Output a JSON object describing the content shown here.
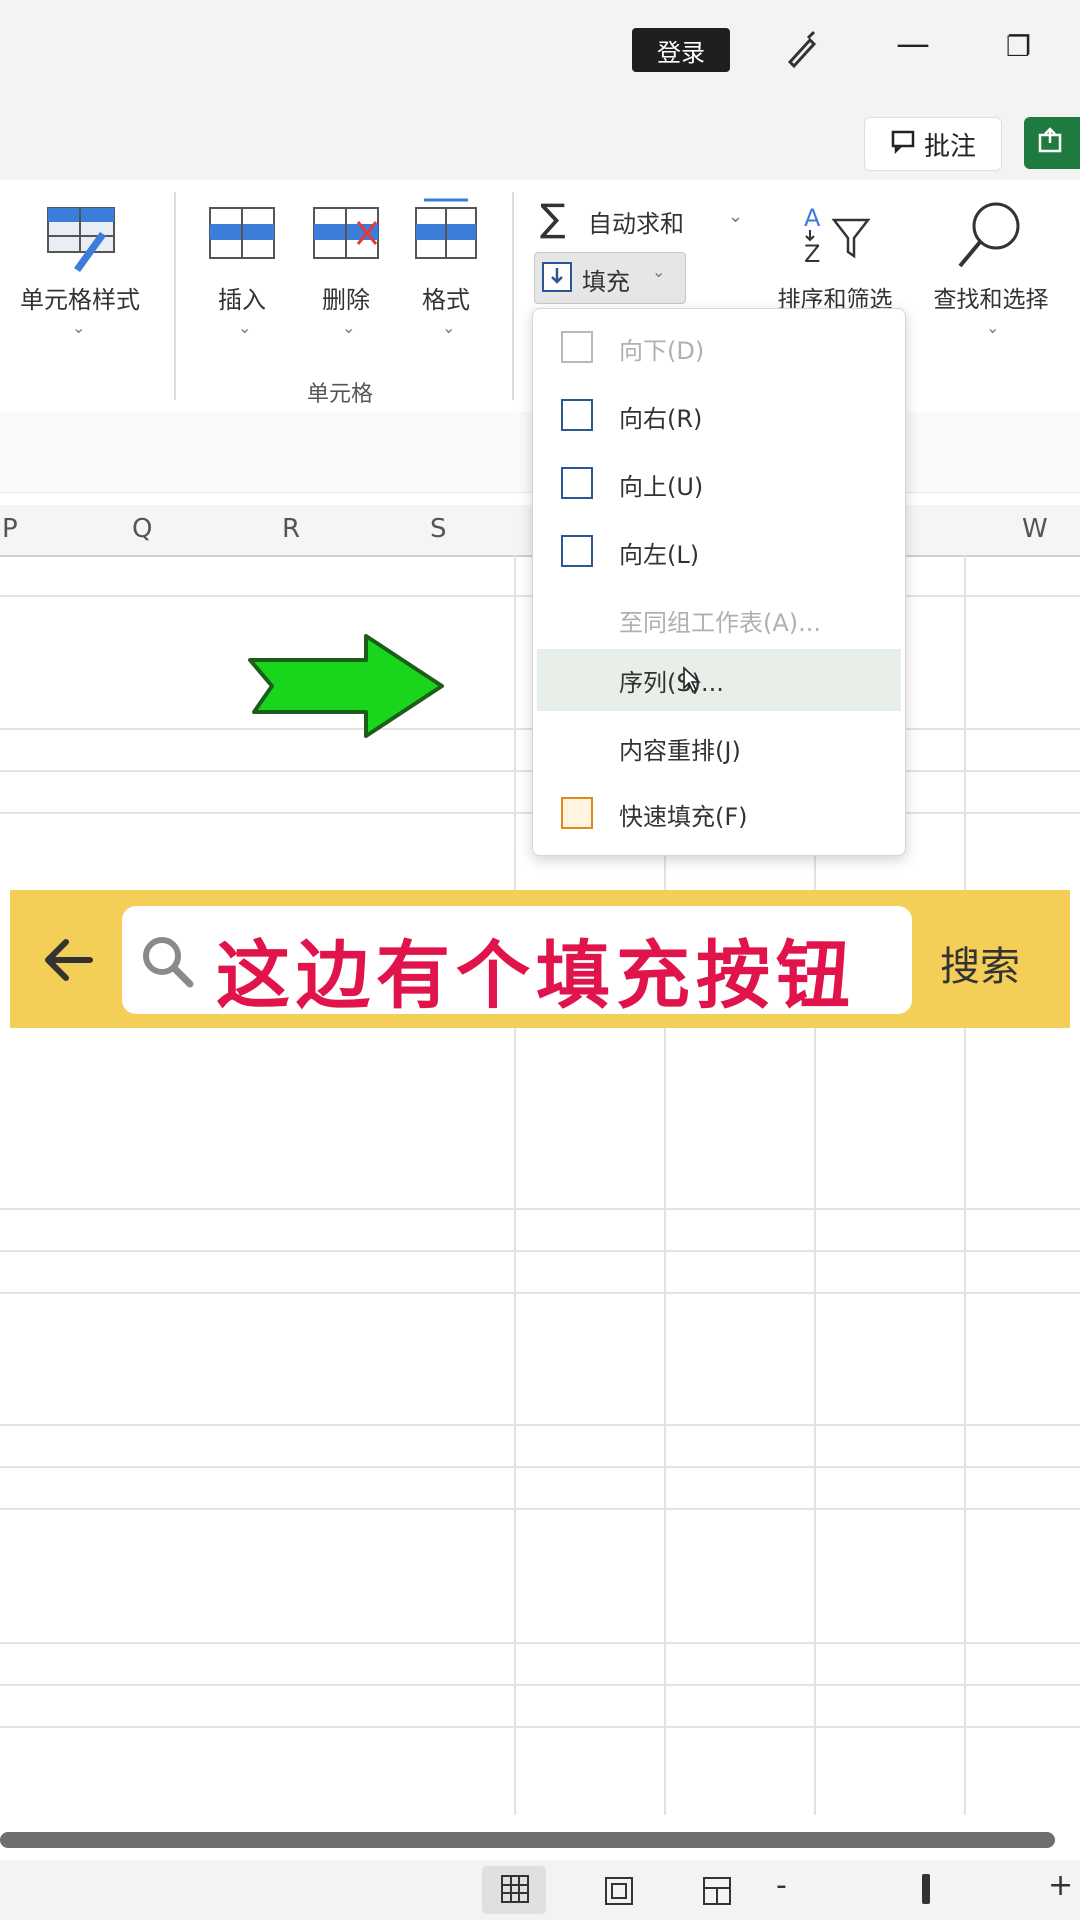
{
  "titlebar": {
    "login_label": "登录",
    "minimize_glyph": "—",
    "restore_glyph": "❐"
  },
  "sharebar": {
    "comment_label": "批注"
  },
  "ribbon": {
    "cell_style_label": "单元格样式",
    "insert_label": "插入",
    "delete_label": "删除",
    "format_label": "格式",
    "cells_group_label": "单元格",
    "autosum_label": "自动求和",
    "fill_label": "填充",
    "sort_filter_label": "排序和筛选",
    "find_select_label": "查找和选择"
  },
  "columns": [
    "P",
    "Q",
    "R",
    "S",
    "W"
  ],
  "fill_menu": {
    "items": [
      {
        "label": "向下(D)",
        "disabled": true
      },
      {
        "label": "向右(R)",
        "disabled": false
      },
      {
        "label": "向上(U)",
        "disabled": false
      },
      {
        "label": "向左(L)",
        "disabled": false
      },
      {
        "label": "至同组工作表(A)...",
        "disabled": true
      },
      {
        "label": "序列(S)...",
        "disabled": false,
        "hover": true
      },
      {
        "label": "内容重排(J)",
        "disabled": false
      },
      {
        "label": "快速填充(F)",
        "disabled": false
      }
    ]
  },
  "banner": {
    "query": "这边有个填充按钮",
    "search_label": "搜索"
  },
  "statusbar": {
    "zoom_out": "-",
    "zoom_in": "+"
  },
  "colors": {
    "banner_bg": "#f4cf57",
    "query_text": "#e0134a",
    "arrow_fill": "#19d61c",
    "share_green": "#1e7a3f"
  }
}
